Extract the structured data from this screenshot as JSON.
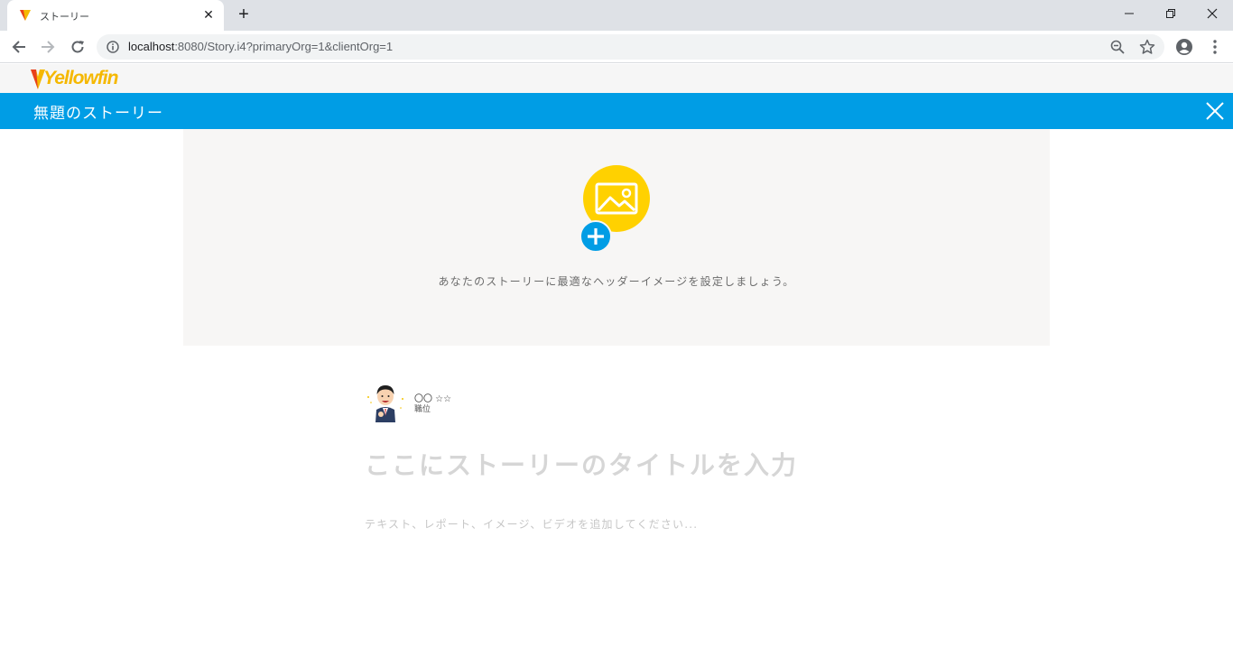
{
  "browser": {
    "tab_title": "ストーリー",
    "url_host": "localhost",
    "url_rest": ":8080/Story.i4?primaryOrg=1&clientOrg=1"
  },
  "app": {
    "logo_text": "Yellowfin",
    "story_name": "無題のストーリー",
    "header_image_hint": "あなたのストーリーに最適なヘッダーイメージを設定しましょう。",
    "author_name": "〇〇 ☆☆",
    "author_role": "職位",
    "title_placeholder": "ここにストーリーのタイトルを入力",
    "body_placeholder": "テキスト、レポート、イメージ、ビデオを追加してください..."
  },
  "colors": {
    "brand_blue": "#009de5",
    "brand_yellow": "#ffd100"
  }
}
